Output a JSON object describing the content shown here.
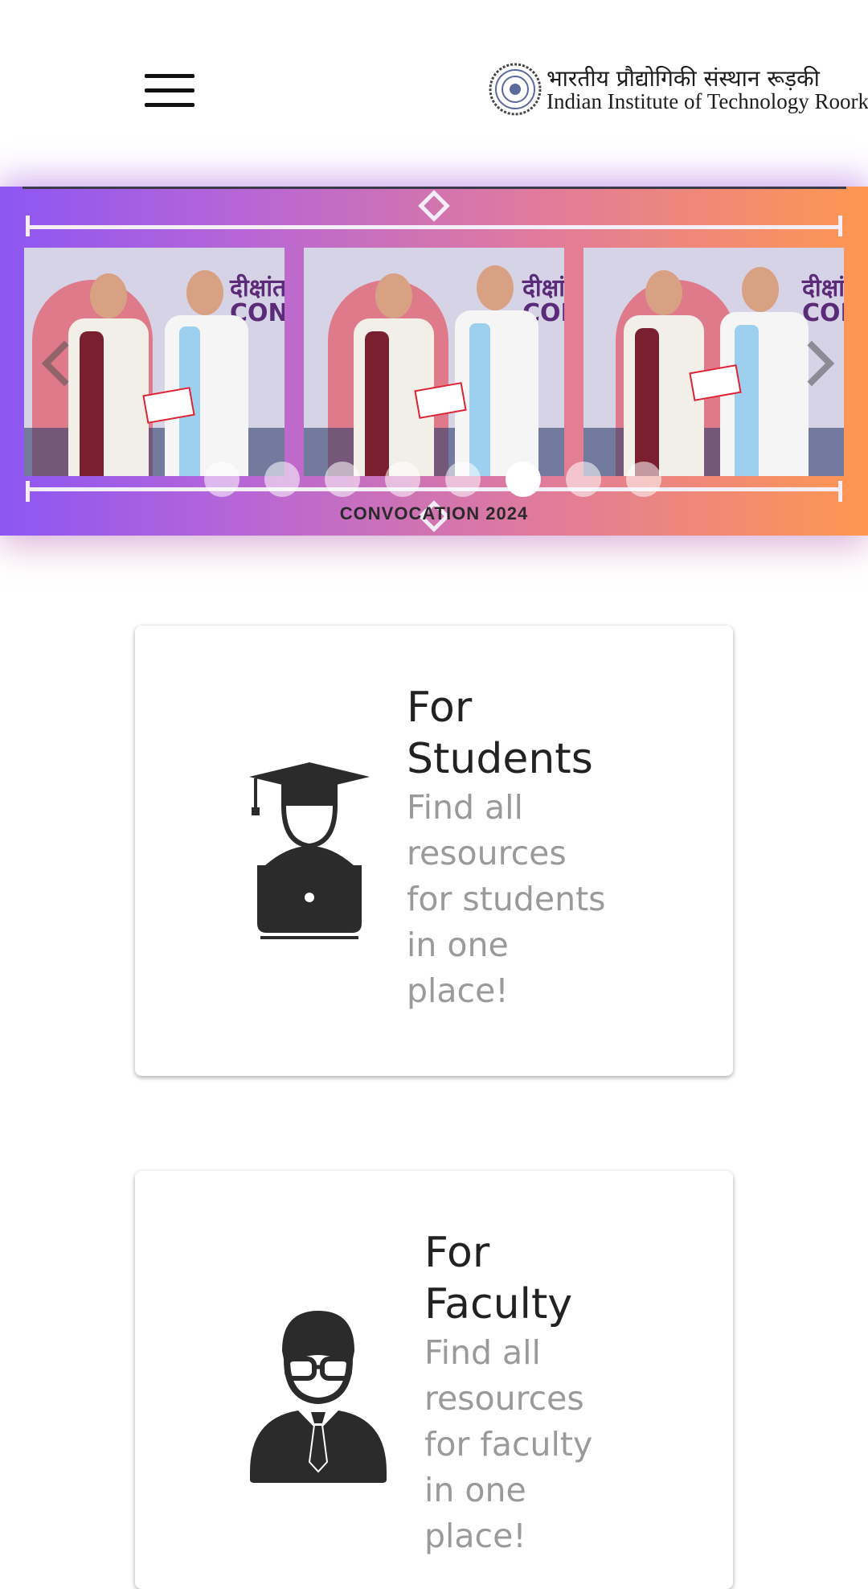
{
  "header": {
    "menu_icon": "hamburger-menu-icon",
    "logo_hindi": "भारतीय प्रौद्योगिकी संस्थान रूड़की",
    "logo_english": "Indian Institute of Technology Roorkee"
  },
  "banner": {
    "caption": "CONVOCATION 2024",
    "photo_text_line1": "दीक्षांत",
    "photo_text_line2": "CON",
    "slide_count": 8,
    "active_slide": 6,
    "gradient_colors": [
      "#8d56f3",
      "#e07b9c",
      "#ff9751"
    ]
  },
  "cards": [
    {
      "icon": "student-laptop-icon",
      "title_line1": "For",
      "title_line2": "Students",
      "desc_lines": [
        "Find all",
        "resources",
        "for students",
        "in one",
        "place!"
      ]
    },
    {
      "icon": "faculty-person-icon",
      "title_line1": "For",
      "title_line2": "Faculty",
      "desc_lines": [
        "Find all",
        "resources",
        "for faculty",
        "in one",
        "place!"
      ]
    }
  ]
}
